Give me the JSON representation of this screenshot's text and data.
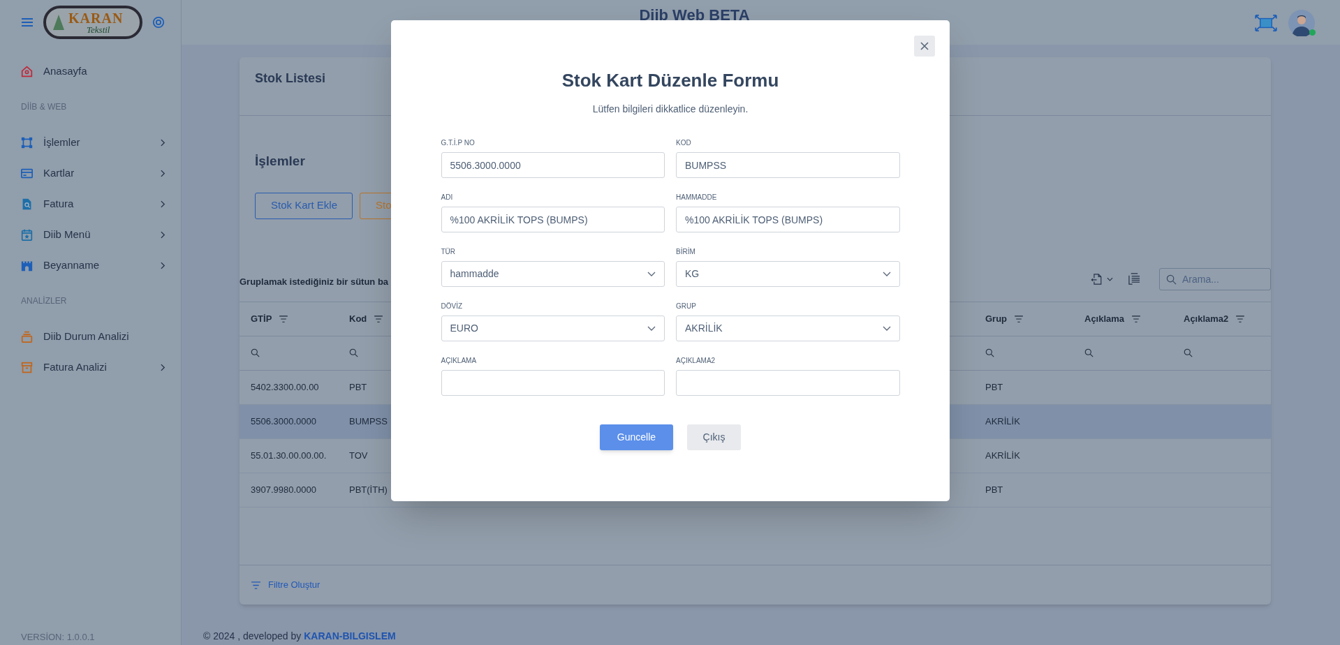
{
  "header": {
    "title": "Diib Web BETA"
  },
  "logo": {
    "name": "KARAN",
    "sub": "Tekstil"
  },
  "sidebar": {
    "items": [
      {
        "kind": "item",
        "label": "Anasayfa",
        "chevron": false
      },
      {
        "kind": "section",
        "label": "DİİB & WEB"
      },
      {
        "kind": "item",
        "label": "İşlemler",
        "chevron": true
      },
      {
        "kind": "item",
        "label": "Kartlar",
        "chevron": true
      },
      {
        "kind": "item",
        "label": "Fatura",
        "chevron": true
      },
      {
        "kind": "item",
        "label": "Diib Menü",
        "chevron": true
      },
      {
        "kind": "item",
        "label": "Beyanname",
        "chevron": true
      },
      {
        "kind": "section",
        "label": "ANALİZLER"
      },
      {
        "kind": "item",
        "label": "Diib Durum Analizi",
        "chevron": false
      },
      {
        "kind": "item",
        "label": "Fatura Analizi",
        "chevron": true
      }
    ],
    "version": "VERSİON: 1.0.0.1"
  },
  "card": {
    "title": "Stok Listesi",
    "section": "İşlemler",
    "buttons": [
      {
        "label": "Stok Kart Ekle",
        "kind": "primary"
      },
      {
        "label": "Sto",
        "kind": "warning"
      }
    ],
    "group_hint": "Gruplamak istediğiniz bir sütun ba",
    "search": {
      "placeholder": "Arama..."
    },
    "table": {
      "columns": [
        "GTİP",
        "Kod",
        "Grup",
        "Açıklama",
        "Açıklama2"
      ],
      "rows": [
        {
          "gtip": "5402.3300.00.00",
          "kod": "PBT",
          "grup": "PBT",
          "selected": false
        },
        {
          "gtip": "5506.3000.0000",
          "kod": "BUMPSS",
          "grup": "AKRİLİK",
          "selected": true
        },
        {
          "gtip": "55.01.30.00.00.00.",
          "kod": "TOV",
          "grup": "AKRİLİK",
          "selected": false
        },
        {
          "gtip": "3907.9980.0000",
          "kod": "PBT(İTH)",
          "grup": "PBT",
          "selected": false
        }
      ]
    },
    "filter_link": "Filtre Oluştur"
  },
  "footer": {
    "text": "© 2024 , developed by ",
    "link": "KARAN-BILGISLEM"
  },
  "modal": {
    "title": "Stok Kart Düzenle Formu",
    "subtitle": "Lütfen bilgileri dikkatlice düzenleyin.",
    "fields": [
      {
        "label": "G.T.İ.P NO",
        "kind": "text",
        "value": "5506.3000.0000"
      },
      {
        "label": "KOD",
        "kind": "text",
        "value": "BUMPSS"
      },
      {
        "label": "ADI",
        "kind": "text",
        "value": "%100 AKRİLİK TOPS (BUMPS)"
      },
      {
        "label": "HAMMADDE",
        "kind": "text",
        "value": "%100 AKRİLİK TOPS (BUMPS)"
      },
      {
        "label": "TÜR",
        "kind": "select",
        "value": "hammadde"
      },
      {
        "label": "BİRİM",
        "kind": "select",
        "value": "KG"
      },
      {
        "label": "DÖVİZ",
        "kind": "select",
        "value": "EURO"
      },
      {
        "label": "GRUP",
        "kind": "select",
        "value": "AKRİLİK"
      },
      {
        "label": "AÇIKLAMA",
        "kind": "text"
      },
      {
        "label": "AÇIKLAMA2",
        "kind": "text"
      }
    ],
    "buttons": [
      {
        "label": "Guncelle",
        "kind": "primary"
      },
      {
        "label": "Çıkış",
        "kind": "secondary"
      }
    ]
  }
}
